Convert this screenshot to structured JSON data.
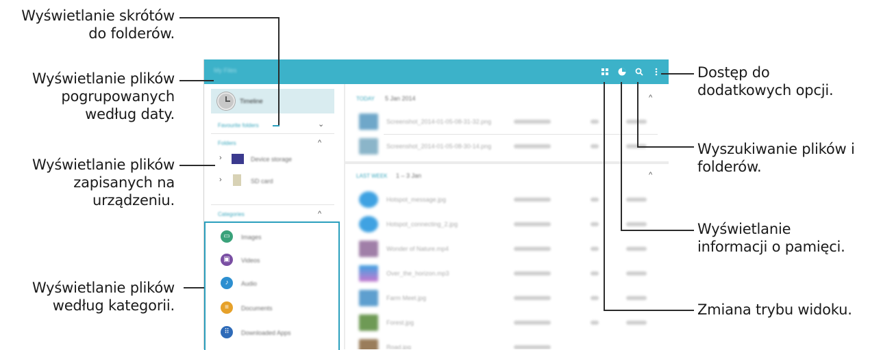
{
  "callouts": {
    "folder_shortcuts": [
      "Wyświetlanie skrótów",
      "do folderów."
    ],
    "by_date": [
      "Wyświetlanie plików",
      "pogrupowanych",
      "według daty."
    ],
    "on_device": [
      "Wyświetlanie plików",
      "zapisanych na",
      "urządzeniu."
    ],
    "by_category": [
      "Wyświetlanie plików",
      "według kategorii."
    ],
    "more_options": [
      "Dostęp do",
      "dodatkowych opcji."
    ],
    "search": [
      "Wyszukiwanie plików i",
      "folderów."
    ],
    "storage_info": [
      "Wyświetlanie",
      "informacji o pamięci."
    ],
    "view_mode": [
      "Zmiana trybu widoku."
    ]
  },
  "app": {
    "title": "My Files",
    "toolbar_icons": [
      "view-mode-grid-icon",
      "storage-pie-icon",
      "search-icon",
      "more-options-icon"
    ],
    "accent_color": "#3cb2c9"
  },
  "sidebar": {
    "timeline_label": "Timeline",
    "favourite_folders_label": "Favourite folders",
    "folders_label": "Folders",
    "folders": [
      {
        "label": "Device storage",
        "icon": "device-storage-icon"
      },
      {
        "label": "SD card",
        "icon": "sd-card-icon"
      }
    ],
    "categories_label": "Categories",
    "categories": [
      {
        "label": "Images",
        "icon": "images-icon",
        "color": "#3aa27a"
      },
      {
        "label": "Videos",
        "icon": "videos-icon",
        "color": "#7a4fa3"
      },
      {
        "label": "Audio",
        "icon": "audio-icon",
        "color": "#2d8fd0"
      },
      {
        "label": "Documents",
        "icon": "documents-icon",
        "color": "#e6a12a"
      },
      {
        "label": "Downloaded Apps",
        "icon": "apps-icon",
        "color": "#2f6bb8"
      }
    ]
  },
  "main": {
    "groups": [
      {
        "label": "TODAY",
        "date": "5 Jan 2014",
        "files": [
          "Screenshot_2014-01-05-08-31-32.png",
          "Screenshot_2014-01-05-08-30-14.png"
        ]
      },
      {
        "label": "LAST WEEK",
        "date": "1 – 3 Jan",
        "files": [
          "Hotspot_message.jpg",
          "Hotspot_connecting_2.jpg",
          "Wonder of Nature.mp4",
          "Over_the_horizon.mp3",
          "Farm Meet.jpg",
          "Forest.jpg",
          "Road.jpg"
        ]
      }
    ]
  }
}
